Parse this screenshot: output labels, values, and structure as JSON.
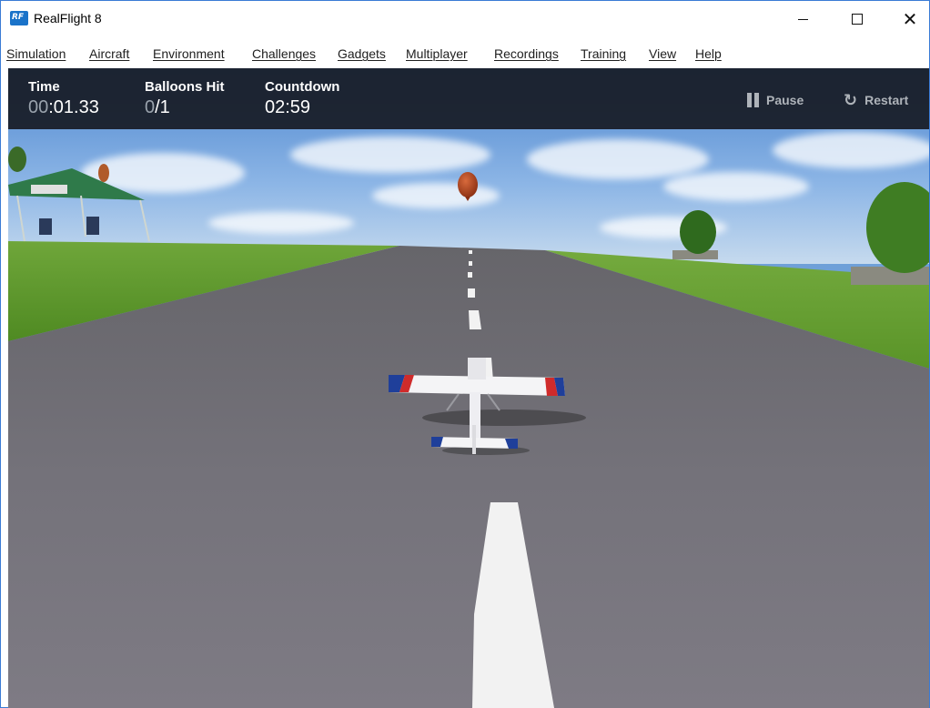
{
  "window": {
    "title": "RealFlight 8",
    "logo_text": "RF",
    "controls": {
      "minimize": "—",
      "maximize": "☐",
      "close": "✕"
    }
  },
  "menu": {
    "items": [
      {
        "label": "Simulation"
      },
      {
        "label": "Aircraft"
      },
      {
        "label": "Environment"
      },
      {
        "label": "Challenges"
      },
      {
        "label": "Gadgets"
      },
      {
        "label": "Multiplayer"
      },
      {
        "label": "Recordings"
      },
      {
        "label": "Training"
      },
      {
        "label": "View"
      },
      {
        "label": "Help"
      }
    ]
  },
  "hud": {
    "time": {
      "label": "Time",
      "value_prefix": "00",
      "value_rest": ":01.33"
    },
    "balloons": {
      "label": "Balloons Hit",
      "value_hit": "0",
      "value_rest": "/1"
    },
    "countdown": {
      "label": "Countdown",
      "value": "02:59"
    },
    "pause": {
      "label": "Pause",
      "icon": "pause-icon"
    },
    "restart": {
      "label": "Restart",
      "icon": "restart-icon"
    }
  },
  "colors": {
    "accent": "#1a73c9",
    "hud_bg": "#181c26",
    "sky": "#6fa0d8",
    "grass": "#5f9a2a",
    "runway": "#6e6c6e",
    "balloon": "#b0441f"
  }
}
